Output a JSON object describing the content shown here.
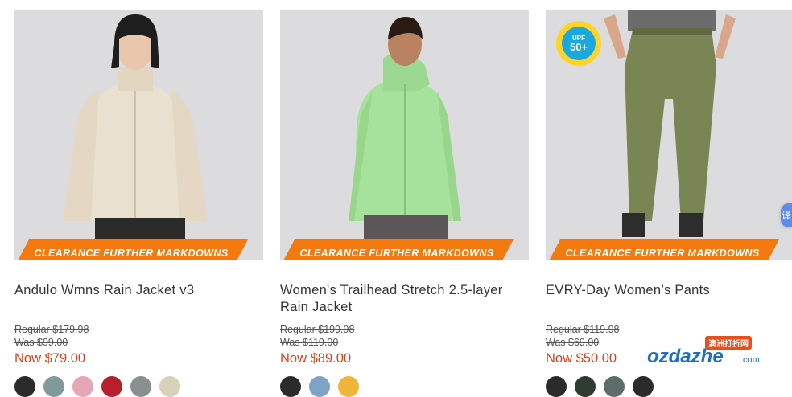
{
  "products": [
    {
      "badge": "CLEARANCE FURTHER MARKDOWNS",
      "title": "Andulo Wmns Rain Jacket v3",
      "regular": "Regular $179.98",
      "was": "Was $99.00",
      "now": "Now $79.00",
      "swatches": [
        "#2b2b2b",
        "#7f9a9a",
        "#e4a7b4",
        "#b81f2c",
        "#8a8f8f",
        "#d8d2bd"
      ]
    },
    {
      "badge": "CLEARANCE FURTHER MARKDOWNS",
      "title": "Women's Trailhead Stretch 2.5-layer Rain Jacket",
      "regular": "Regular $199.98",
      "was": "Was $119.00",
      "now": "Now $89.00",
      "swatches": [
        "#2b2b2b",
        "#7ea3c4",
        "#f0b43a"
      ]
    },
    {
      "badge": "CLEARANCE FURTHER MARKDOWNS",
      "title": "EVRY-Day Women’s Pants",
      "regular": "Regular $119.98",
      "was": "Was $69.00",
      "now": "Now $50.00",
      "upf": {
        "label": "UPF",
        "value": "50+"
      },
      "swatches": [
        "#2b2b2b",
        "#2f3a30",
        "#5d6e6a",
        "#2b2b2b"
      ]
    }
  ],
  "translate_tab": "译",
  "watermark": {
    "tag": "澳洲打折网",
    "text": "ozdazhe",
    "suffix": ".com"
  }
}
